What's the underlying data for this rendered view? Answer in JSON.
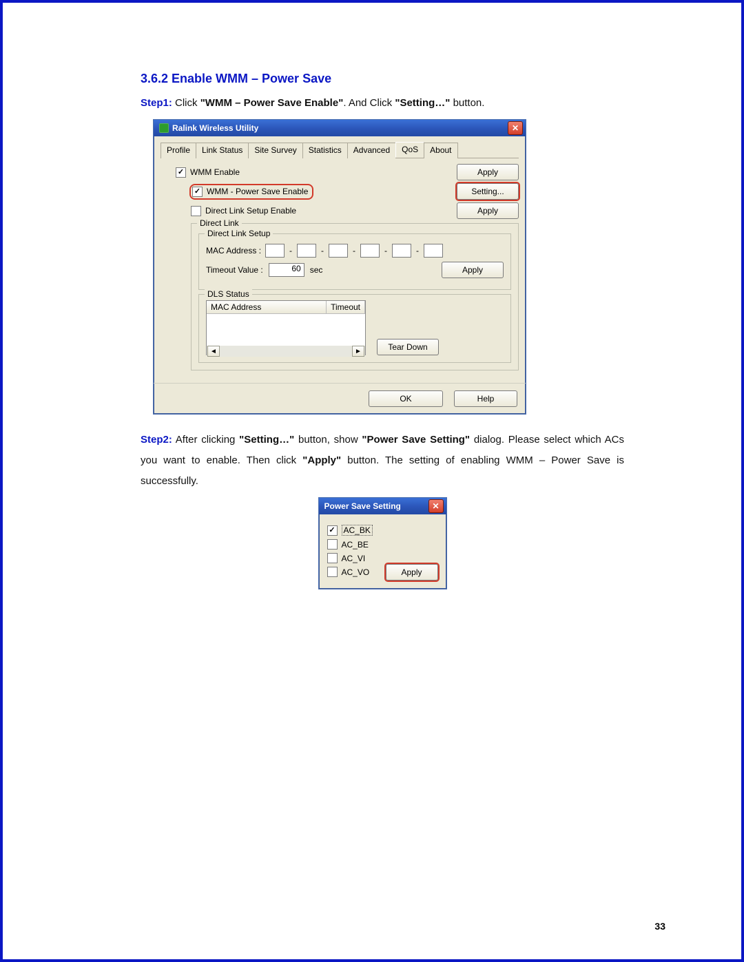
{
  "heading": "3.6.2 Enable WMM – Power Save",
  "step1": {
    "label": "Step1:",
    "text_before": " Click ",
    "bold1": "\"WMM – Power Save Enable\"",
    "text_mid": ". And Click ",
    "bold2": "\"Setting…\"",
    "text_after": " button."
  },
  "dialog1": {
    "title": "Ralink Wireless Utility",
    "tabs": [
      "Profile",
      "Link Status",
      "Site Survey",
      "Statistics",
      "Advanced",
      "QoS",
      "About"
    ],
    "active_tab_index": 5,
    "wmm_enable": "WMM Enable",
    "power_save_enable": "WMM - Power Save Enable",
    "direct_link_enable": "Direct Link Setup Enable",
    "btn_apply": "Apply",
    "btn_setting": "Setting...",
    "group_direct_link": "Direct Link",
    "group_direct_link_setup": "Direct Link Setup",
    "mac_label": "MAC Address :",
    "timeout_label": "Timeout Value :",
    "timeout_value": "60",
    "timeout_unit": "sec",
    "btn_apply2": "Apply",
    "group_dls_status": "DLS Status",
    "col_mac": "MAC Address",
    "col_timeout": "Timeout",
    "btn_teardown": "Tear Down",
    "btn_ok": "OK",
    "btn_help": "Help"
  },
  "step2": {
    "label": "Step2:",
    "t1": " After clicking ",
    "b1": "\"Setting…\"",
    "t2": " button, show ",
    "b2": "\"Power Save Setting\"",
    "t3": " dialog. Please select which ACs you want to enable. Then click ",
    "b3": "\"Apply\"",
    "t4": " button. The setting of enabling WMM – Power Save is successfully."
  },
  "dialog2": {
    "title": "Power Save Setting",
    "ac_bk": "AC_BK",
    "ac_be": "AC_BE",
    "ac_vi": "AC_VI",
    "ac_vo": "AC_VO",
    "btn_apply": "Apply"
  },
  "page_number": "33"
}
